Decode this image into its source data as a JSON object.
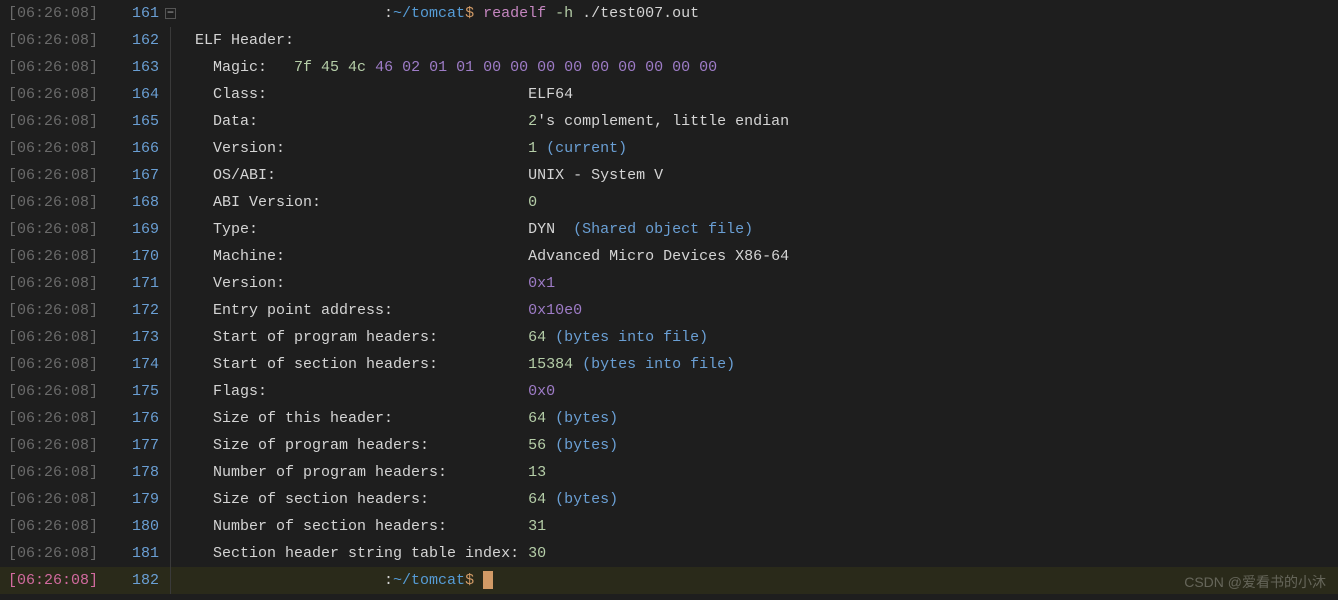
{
  "timestamp": "[06:26:08]",
  "watermark": "CSDN @爱看书的小沐",
  "prompt": {
    "path": "~/tomcat",
    "dollar": "$",
    "command": "readelf",
    "flag": "-h",
    "arg": "./test007.out"
  },
  "lines": [
    {
      "no": "161",
      "type": "prompt"
    },
    {
      "no": "162",
      "type": "header",
      "text": "ELF Header:"
    },
    {
      "no": "163",
      "type": "magic",
      "label": "Magic:",
      "v1": "7f 45 4c",
      "v2": "46 02 01 01 00 00 00 00 00 00 00 00 00"
    },
    {
      "no": "164",
      "type": "kv",
      "key": "Class:",
      "pad": "                             ",
      "val": "ELF64"
    },
    {
      "no": "165",
      "type": "kv",
      "key": "Data:",
      "pad": "                              ",
      "val_n": "2",
      "val_t": "'s complement, little endian"
    },
    {
      "no": "166",
      "type": "kv",
      "key": "Version:",
      "pad": "                           ",
      "val_n": "1",
      "paren": "(current)"
    },
    {
      "no": "167",
      "type": "kv",
      "key": "OS/ABI:",
      "pad": "                            ",
      "val": "UNIX - System V"
    },
    {
      "no": "168",
      "type": "kv",
      "key": "ABI Version:",
      "pad": "                       ",
      "val_n": "0"
    },
    {
      "no": "169",
      "type": "kv",
      "key": "Type:",
      "pad": "                              ",
      "val": "DYN ",
      "paren": "(Shared object file)"
    },
    {
      "no": "170",
      "type": "kv",
      "key": "Machine:",
      "pad": "                           ",
      "val": "Advanced Micro Devices X86-64"
    },
    {
      "no": "171",
      "type": "kv",
      "key": "Version:",
      "pad": "                           ",
      "val_hex": "0x1"
    },
    {
      "no": "172",
      "type": "kv",
      "key": "Entry point address:",
      "pad": "               ",
      "val_hex": "0x10e0"
    },
    {
      "no": "173",
      "type": "kv",
      "key": "Start of program headers:",
      "pad": "          ",
      "val_n": "64",
      "paren": "(bytes into file)"
    },
    {
      "no": "174",
      "type": "kv",
      "key": "Start of section headers:",
      "pad": "          ",
      "val_n": "15384",
      "paren": "(bytes into file)"
    },
    {
      "no": "175",
      "type": "kv",
      "key": "Flags:",
      "pad": "                             ",
      "val_hex": "0x0"
    },
    {
      "no": "176",
      "type": "kv",
      "key": "Size of this header:",
      "pad": "               ",
      "val_n": "64",
      "paren": "(bytes)"
    },
    {
      "no": "177",
      "type": "kv",
      "key": "Size of program headers:",
      "pad": "           ",
      "val_n": "56",
      "paren": "(bytes)"
    },
    {
      "no": "178",
      "type": "kv",
      "key": "Number of program headers:",
      "pad": "         ",
      "val_n": "13"
    },
    {
      "no": "179",
      "type": "kv",
      "key": "Size of section headers:",
      "pad": "           ",
      "val_n": "64",
      "paren": "(bytes)"
    },
    {
      "no": "180",
      "type": "kv",
      "key": "Number of section headers:",
      "pad": "         ",
      "val_n": "31"
    },
    {
      "no": "181",
      "type": "kv",
      "key": "Section header string table index:",
      "pad": " ",
      "val_n": "30"
    },
    {
      "no": "182",
      "type": "prompt_end"
    }
  ]
}
